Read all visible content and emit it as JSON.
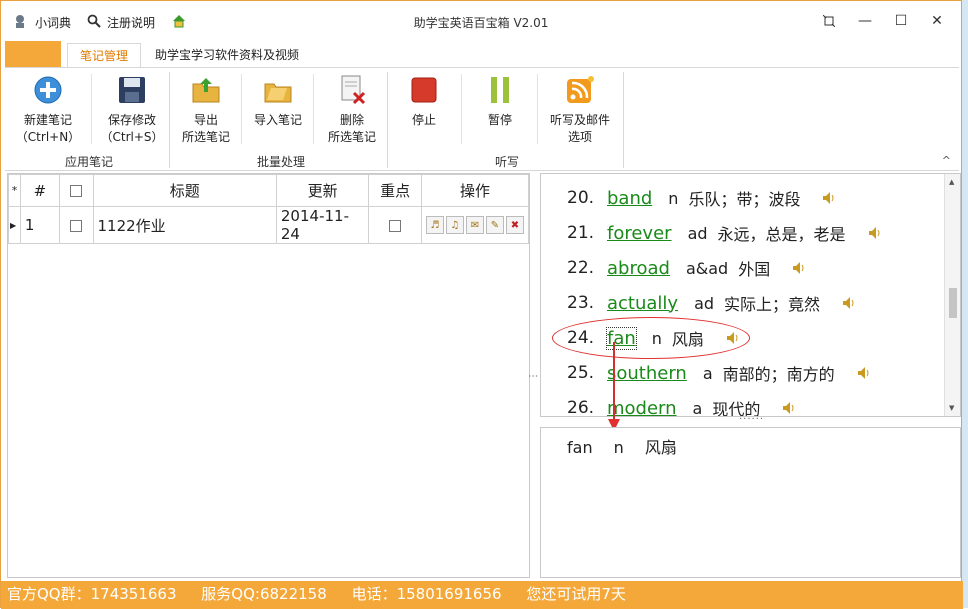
{
  "titlebar": {
    "dictionary": "小词典",
    "register": "注册说明",
    "title": "助学宝英语百宝箱 V2.01"
  },
  "tabs": [
    {
      "label": "笔记管理"
    },
    {
      "label": "助学宝学习软件资料及视频"
    }
  ],
  "ribbon": {
    "new_note": [
      "新建笔记",
      "（Ctrl+N）"
    ],
    "save_note": [
      "保存修改",
      "（Ctrl+S）"
    ],
    "export": [
      "导出",
      "所选笔记"
    ],
    "import": "导入笔记",
    "delete": [
      "删除",
      "所选笔记"
    ],
    "stop": "停止",
    "pause": "暂停",
    "dictation": [
      "听写及邮件",
      "选项"
    ],
    "groups": {
      "apply": "应用笔记",
      "batch": "批量处理",
      "dictate": "听写"
    }
  },
  "grid": {
    "headers": {
      "star": "*",
      "num": "#",
      "title": "标题",
      "updated": "更新",
      "key": "重点",
      "ops": "操作"
    },
    "rows": [
      {
        "num": "1",
        "title": "1122作业",
        "updated": "2014-11-24"
      }
    ]
  },
  "words": [
    {
      "num": "20.",
      "word": "band",
      "pos": "n",
      "meaning": "乐队；带；波段"
    },
    {
      "num": "21.",
      "word": "forever",
      "pos": "ad",
      "meaning": "永远，总是，老是"
    },
    {
      "num": "22.",
      "word": "abroad",
      "pos": "a&ad",
      "meaning": "外国"
    },
    {
      "num": "23.",
      "word": "actually",
      "pos": "ad",
      "meaning": "实际上；竟然"
    },
    {
      "num": "24.",
      "word": "fan",
      "pos": "n",
      "meaning": "风扇"
    },
    {
      "num": "25.",
      "word": "southern",
      "pos": "a",
      "meaning": "南部的；南方的"
    },
    {
      "num": "26.",
      "word": "modern",
      "pos": "a",
      "meaning": "现代的"
    }
  ],
  "detail": {
    "word": "fan",
    "pos": "n",
    "meaning": "风扇"
  },
  "status": {
    "qq_group": "官方QQ群：174351663",
    "service_qq": "服务QQ:6822158",
    "phone": "电话：15801691656",
    "trial": "您还可试用7天"
  },
  "colors": {
    "accent": "#f5a83a",
    "word_link": "#1a8a1a",
    "highlight": "#e03030"
  }
}
